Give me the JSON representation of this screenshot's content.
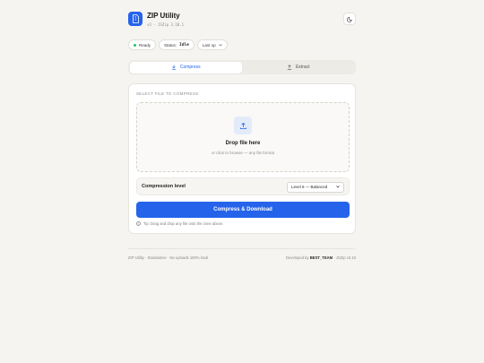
{
  "app": {
    "title": "ZIP Utility",
    "version": "v3",
    "separator": "·",
    "engine": "JSZip 3.10.1",
    "logo_icon": "zip-file-icon",
    "accent": "#2563eb"
  },
  "header": {
    "theme_toggle_icon": "moon-icon"
  },
  "status": {
    "ready_label": "Ready",
    "status_prefix": "Status:",
    "status_value": "Idle",
    "last_op_label": "Last op"
  },
  "tabs": [
    {
      "label": "Compress",
      "icon": "download-icon",
      "active": true
    },
    {
      "label": "Extract",
      "icon": "upload-icon",
      "active": false
    }
  ],
  "compress": {
    "section_label": "SELECT FILE TO COMPRESS",
    "drop_title": "Drop file here",
    "drop_hint": "or click to browse — any file format",
    "level_label": "Compression level",
    "level_selected": "Level 6 — Balanced",
    "cta_label": "Compress & Download",
    "tip": "Tip: Drag and drop any file onto the zone above."
  },
  "footer": {
    "left": "ZIP Utility · Standalone · No uploads 100% local",
    "right_prefix": "Developed by",
    "right_team": "BEST_TEAM",
    "right_suffix": "· JSZip v3.10"
  }
}
